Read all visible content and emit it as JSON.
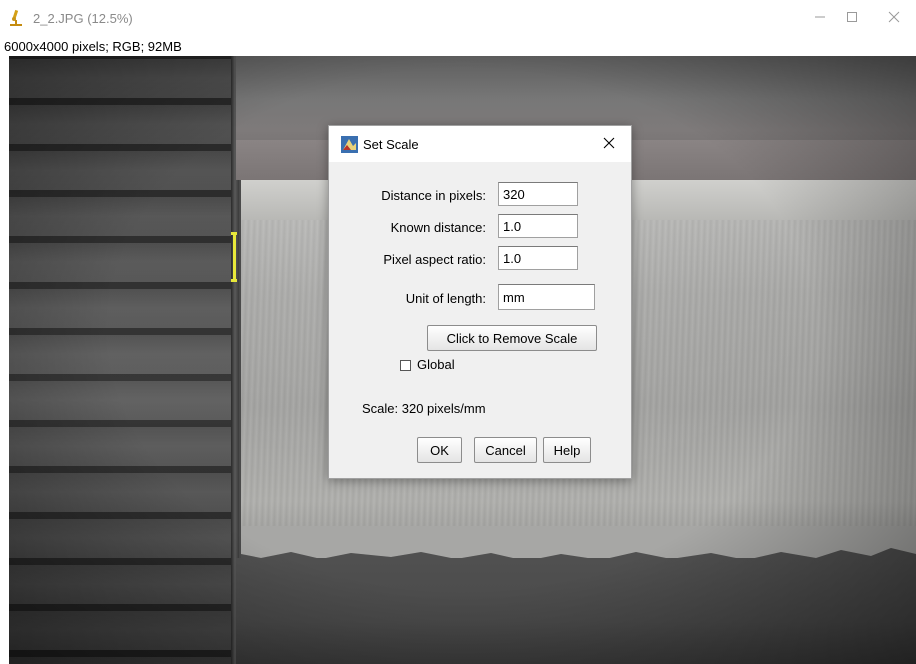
{
  "window": {
    "title": "2_2.JPG (12.5%)",
    "info": "6000x4000 pixels; RGB; 92MB",
    "controls": {
      "minimize": "—",
      "maximize": "☐",
      "close": "✕"
    }
  },
  "dialog": {
    "title": "Set Scale",
    "fields": {
      "distance_in_pixels": {
        "label": "Distance in pixels:",
        "value": "320"
      },
      "known_distance": {
        "label": "Known distance:",
        "value": "1.0"
      },
      "pixel_aspect_ratio": {
        "label": "Pixel aspect ratio:",
        "value": "1.0"
      },
      "unit_of_length": {
        "label": "Unit of length:",
        "value": "mm"
      }
    },
    "remove_scale_label": "Click to Remove Scale",
    "global": {
      "label": "Global",
      "checked": false
    },
    "scale_text": "Scale: 320 pixels/mm",
    "buttons": {
      "ok": "OK",
      "cancel": "Cancel",
      "help": "Help"
    }
  },
  "colors": {
    "selection": "#e8e83a",
    "app_icon": "#d4a017"
  },
  "icons": {
    "app": "microscope-icon",
    "dialog": "imagej-icon",
    "close": "close-icon"
  }
}
